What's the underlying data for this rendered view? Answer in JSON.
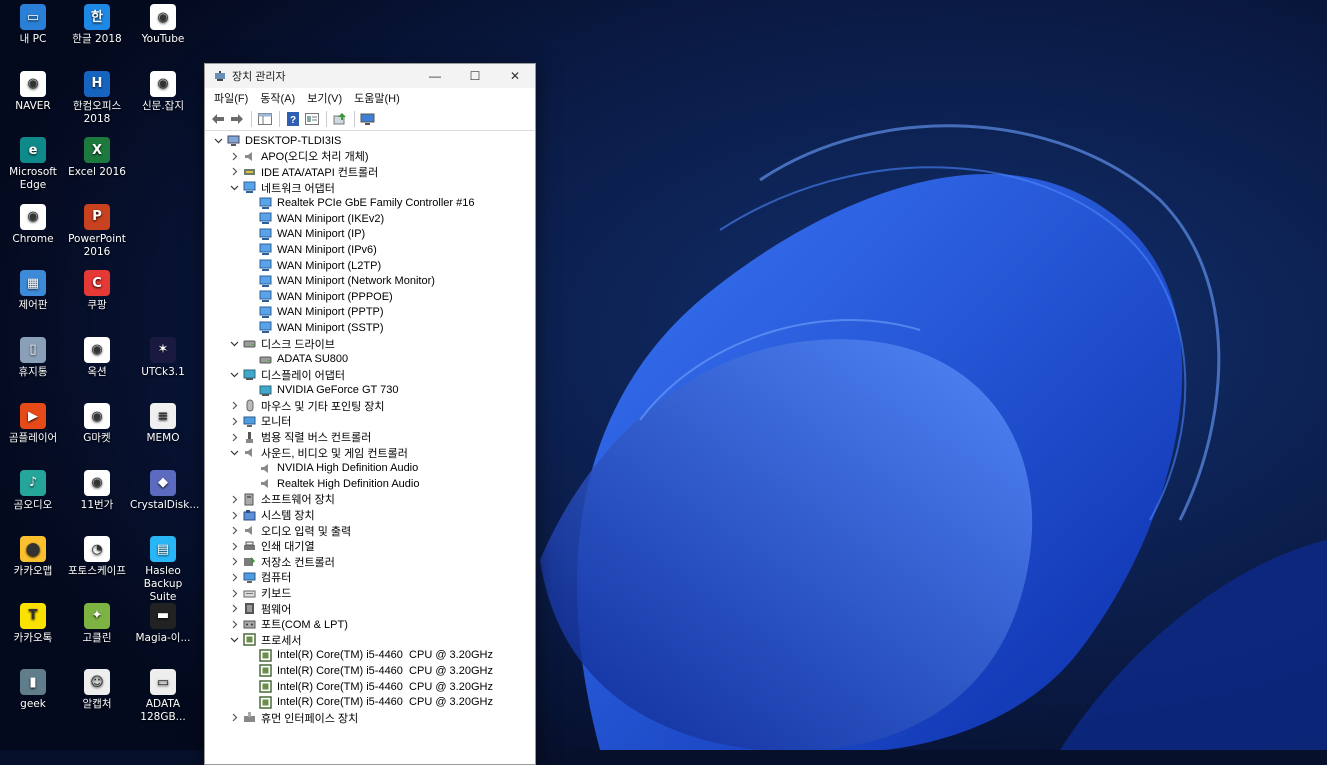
{
  "desktop": {
    "icons": [
      {
        "label": "내 PC",
        "color": "#2a7fd6",
        "glyph": "▭",
        "col": 0,
        "row": 0
      },
      {
        "label": "한글 2018",
        "color": "#1e88e5",
        "glyph": "한",
        "col": 1,
        "row": 0
      },
      {
        "label": "YouTube",
        "color": "#ffffff",
        "glyph": "◉",
        "col": 2,
        "row": 0
      },
      {
        "label": "NAVER",
        "color": "#ffffff",
        "glyph": "◉",
        "col": 0,
        "row": 1
      },
      {
        "label": "한컴오피스 2018",
        "color": "#1565c0",
        "glyph": "H",
        "col": 1,
        "row": 1
      },
      {
        "label": "신문.잡지",
        "color": "#ffffff",
        "glyph": "◉",
        "col": 2,
        "row": 1
      },
      {
        "label": "Microsoft Edge",
        "color": "#0f8a8a",
        "glyph": "e",
        "col": 0,
        "row": 2
      },
      {
        "label": "Excel 2016",
        "color": "#1d7a3e",
        "glyph": "X",
        "col": 1,
        "row": 2
      },
      {
        "label": "Chrome",
        "color": "#ffffff",
        "glyph": "◉",
        "col": 0,
        "row": 3
      },
      {
        "label": "PowerPoint 2016",
        "color": "#c8421f",
        "glyph": "P",
        "col": 1,
        "row": 3
      },
      {
        "label": "제어판",
        "color": "#3d8bd8",
        "glyph": "▦",
        "col": 0,
        "row": 4
      },
      {
        "label": "쿠팡",
        "color": "#e53935",
        "glyph": "C",
        "col": 1,
        "row": 4
      },
      {
        "label": "휴지통",
        "color": "#8aa0b8",
        "glyph": "▯",
        "col": 0,
        "row": 5
      },
      {
        "label": "옥션",
        "color": "#ffffff",
        "glyph": "◉",
        "col": 1,
        "row": 5
      },
      {
        "label": "UTCk3.1",
        "color": "#1a1a40",
        "glyph": "✶",
        "col": 2,
        "row": 5
      },
      {
        "label": "곰플레이어",
        "color": "#e64a19",
        "glyph": "▶",
        "col": 0,
        "row": 6
      },
      {
        "label": "G마켓",
        "color": "#ffffff",
        "glyph": "◉",
        "col": 1,
        "row": 6
      },
      {
        "label": "MEMO",
        "color": "#f0f0f0",
        "glyph": "≡",
        "col": 2,
        "row": 6
      },
      {
        "label": "곰오디오",
        "color": "#26a69a",
        "glyph": "♪",
        "col": 0,
        "row": 7
      },
      {
        "label": "11번가",
        "color": "#ffffff",
        "glyph": "◉",
        "col": 1,
        "row": 7
      },
      {
        "label": "CrystalDisk...",
        "color": "#5c6bc0",
        "glyph": "◆",
        "col": 2,
        "row": 7
      },
      {
        "label": "카카오맵",
        "color": "#fbc02d",
        "glyph": "⬤",
        "col": 0,
        "row": 8
      },
      {
        "label": "포토스케이프",
        "color": "#ffffff",
        "glyph": "◔",
        "col": 1,
        "row": 8
      },
      {
        "label": "Hasleo Backup Suite",
        "color": "#29b6f6",
        "glyph": "▤",
        "col": 2,
        "row": 8
      },
      {
        "label": "카카오톡",
        "color": "#fae100",
        "glyph": "T",
        "col": 0,
        "row": 9
      },
      {
        "label": "고클린",
        "color": "#7cb342",
        "glyph": "✦",
        "col": 1,
        "row": 9
      },
      {
        "label": "Magia-이...",
        "color": "#222222",
        "glyph": "▬",
        "col": 2,
        "row": 9
      },
      {
        "label": "geek",
        "color": "#607d8b",
        "glyph": "▮",
        "col": 0,
        "row": 10
      },
      {
        "label": "알캡처",
        "color": "#eeeeee",
        "glyph": "☺",
        "col": 1,
        "row": 10
      },
      {
        "label": "ADATA 128GB...",
        "color": "#eeeeee",
        "glyph": "▭",
        "col": 2,
        "row": 10
      }
    ]
  },
  "window": {
    "title": "장치 관리자",
    "controls": {
      "minimize": "—",
      "maximize": "☐",
      "close": "✕"
    },
    "menu": [
      "파일(F)",
      "동작(A)",
      "보기(V)",
      "도움말(H)"
    ],
    "tree": [
      {
        "label": "DESKTOP-TLDI3IS",
        "level": 0,
        "expander": "expanded",
        "icon": "computer"
      },
      {
        "label": "APO(오디오 처리 개체)",
        "level": 1,
        "expander": "collapsed",
        "icon": "speaker"
      },
      {
        "label": "IDE ATA/ATAPI 컨트롤러",
        "level": 1,
        "expander": "collapsed",
        "icon": "ide"
      },
      {
        "label": "네트워크 어댑터",
        "level": 1,
        "expander": "expanded",
        "icon": "network"
      },
      {
        "label": "Realtek PCIe GbE Family Controller #16",
        "level": 2,
        "expander": "none",
        "icon": "network"
      },
      {
        "label": "WAN Miniport (IKEv2)",
        "level": 2,
        "expander": "none",
        "icon": "network"
      },
      {
        "label": "WAN Miniport (IP)",
        "level": 2,
        "expander": "none",
        "icon": "network"
      },
      {
        "label": "WAN Miniport (IPv6)",
        "level": 2,
        "expander": "none",
        "icon": "network"
      },
      {
        "label": "WAN Miniport (L2TP)",
        "level": 2,
        "expander": "none",
        "icon": "network"
      },
      {
        "label": "WAN Miniport (Network Monitor)",
        "level": 2,
        "expander": "none",
        "icon": "network"
      },
      {
        "label": "WAN Miniport (PPPOE)",
        "level": 2,
        "expander": "none",
        "icon": "network"
      },
      {
        "label": "WAN Miniport (PPTP)",
        "level": 2,
        "expander": "none",
        "icon": "network"
      },
      {
        "label": "WAN Miniport (SSTP)",
        "level": 2,
        "expander": "none",
        "icon": "network"
      },
      {
        "label": "디스크 드라이브",
        "level": 1,
        "expander": "expanded",
        "icon": "disk"
      },
      {
        "label": "ADATA SU800",
        "level": 2,
        "expander": "none",
        "icon": "disk"
      },
      {
        "label": "디스플레이 어댑터",
        "level": 1,
        "expander": "expanded",
        "icon": "display"
      },
      {
        "label": "NVIDIA GeForce GT 730",
        "level": 2,
        "expander": "none",
        "icon": "display"
      },
      {
        "label": "마우스 및 기타 포인팅 장치",
        "level": 1,
        "expander": "collapsed",
        "icon": "mouse"
      },
      {
        "label": "모니터",
        "level": 1,
        "expander": "collapsed",
        "icon": "monitor"
      },
      {
        "label": "범용 직렬 버스 컨트롤러",
        "level": 1,
        "expander": "collapsed",
        "icon": "usb"
      },
      {
        "label": "사운드, 비디오 및 게임 컨트롤러",
        "level": 1,
        "expander": "expanded",
        "icon": "speaker"
      },
      {
        "label": "NVIDIA High Definition Audio",
        "level": 2,
        "expander": "none",
        "icon": "speaker"
      },
      {
        "label": "Realtek High Definition Audio",
        "level": 2,
        "expander": "none",
        "icon": "speaker"
      },
      {
        "label": "소프트웨어 장치",
        "level": 1,
        "expander": "collapsed",
        "icon": "software"
      },
      {
        "label": "시스템 장치",
        "level": 1,
        "expander": "collapsed",
        "icon": "system"
      },
      {
        "label": "오디오 입력 및 출력",
        "level": 1,
        "expander": "collapsed",
        "icon": "speaker"
      },
      {
        "label": "인쇄 대기열",
        "level": 1,
        "expander": "collapsed",
        "icon": "printer"
      },
      {
        "label": "저장소 컨트롤러",
        "level": 1,
        "expander": "collapsed",
        "icon": "storage"
      },
      {
        "label": "컴퓨터",
        "level": 1,
        "expander": "collapsed",
        "icon": "monitor"
      },
      {
        "label": "키보드",
        "level": 1,
        "expander": "collapsed",
        "icon": "keyboard"
      },
      {
        "label": "펌웨어",
        "level": 1,
        "expander": "collapsed",
        "icon": "firmware"
      },
      {
        "label": "포트(COM & LPT)",
        "level": 1,
        "expander": "collapsed",
        "icon": "port"
      },
      {
        "label": "프로세서",
        "level": 1,
        "expander": "expanded",
        "icon": "cpu"
      },
      {
        "label": "Intel(R) Core(TM) i5-4460  CPU @ 3.20GHz",
        "level": 2,
        "expander": "none",
        "icon": "cpu"
      },
      {
        "label": "Intel(R) Core(TM) i5-4460  CPU @ 3.20GHz",
        "level": 2,
        "expander": "none",
        "icon": "cpu"
      },
      {
        "label": "Intel(R) Core(TM) i5-4460  CPU @ 3.20GHz",
        "level": 2,
        "expander": "none",
        "icon": "cpu"
      },
      {
        "label": "Intel(R) Core(TM) i5-4460  CPU @ 3.20GHz",
        "level": 2,
        "expander": "none",
        "icon": "cpu"
      },
      {
        "label": "휴먼 인터페이스 장치",
        "level": 1,
        "expander": "collapsed",
        "icon": "hid"
      }
    ]
  },
  "colors": {
    "wallpaper_dark": "#06102a",
    "wallpaper_blue": "#1a4fd8",
    "accent": "#2a7fd6"
  }
}
